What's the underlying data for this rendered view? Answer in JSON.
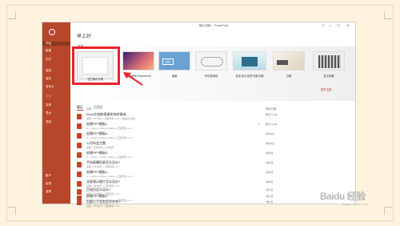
{
  "app": {
    "title": "演示文稿1 - PowerPoint",
    "window_controls": [
      "?",
      "—",
      "☐",
      "✕"
    ]
  },
  "sidebar": {
    "items": [
      {
        "label": "开始",
        "active": true
      },
      {
        "label": "新建"
      },
      {
        "label": "打开"
      },
      {
        "label": "信息"
      },
      {
        "label": "保存"
      },
      {
        "label": "另存为"
      },
      {
        "label": "打印"
      },
      {
        "label": "共享"
      },
      {
        "label": "导出"
      },
      {
        "label": "关闭"
      },
      {
        "label": "账户"
      },
      {
        "label": "反馈"
      },
      {
        "label": "选项"
      }
    ]
  },
  "home": {
    "greeting": "早上好",
    "new_label": "新建",
    "templates": [
      {
        "caption": "空白演示文稿"
      },
      {
        "caption": "欢迎使用 PowerPoint"
      },
      {
        "caption": "画廊",
        "thumb_text": "画廊"
      },
      {
        "caption": "环形装饰线"
      },
      {
        "caption": "包含“设计创意”的新文稿"
      },
      {
        "caption": "日照"
      },
      {
        "caption": "复古风格"
      }
    ],
    "more_themes": "更多主题 →",
    "tabs": [
      {
        "label": "最近",
        "active": true
      },
      {
        "label": "已固定"
      }
    ],
    "columns": {
      "name": "名称",
      "modified": "修改日期"
    },
    "recent_files": [
      {
        "name": "Word文档和表格如何转换成...",
        "path": "桌面 » PPT技巧 » 百度经验 » 2.8 » 桌面演示文稿",
        "date": "昨天 11:35",
        "pinned": false
      },
      {
        "name": "创建PPT模板1",
        "path": "D: » Users » Surlaq » Videos » 百度经验 » 2.3",
        "date": "昨天 11:05",
        "pinned": true
      },
      {
        "name": "创建PPT模板6",
        "path": "D: » Users » Surlaq » Videos » 百度经验 » 2.3",
        "date": "3月15日",
        "pinned": false
      },
      {
        "name": "公司年会主题",
        "path": "桌面 » 百度经验 » 公司文件",
        "date": "3月10日",
        "pinned": false
      },
      {
        "name": "创建PPT模板5",
        "path": "D: » Users » Surlaq » Videos » 百度经验 » 2.3",
        "date": "3月9日",
        "pinned": false
      },
      {
        "name": "手机屏幕投屏怎么设计?",
        "path": "桌面 » PPT技巧 » 百度经验 » 2.7",
        "date": "3月9日",
        "pinned": false
      },
      {
        "name": "创建PPT模板4",
        "path": "D: » Users » Surlaq » Videos » 百度经验 » 2.3",
        "date": "3月8日",
        "pinned": false
      },
      {
        "name": "全屏演示图片怎么设计?",
        "path": "桌面 » PPT技巧 » 百度经验 » 2.6",
        "date": "3月8日",
        "pinned": false
      },
      {
        "name": "目录页怎么设计?",
        "path": "桌面 » PPT技巧 » 百度经验 » 2.5",
        "date": "3月7日",
        "pinned": false
      },
      {
        "name": "创建PPT模板3",
        "path": "D: » Users » Surlaq » Videos » 百度经验 » 2.3",
        "date": "3月7日",
        "pinned": false
      },
      {
        "name": "页面上下左右怎么对齐?",
        "path": "桌面 » PPT技巧 » 百度经验 » 2.4",
        "date": "3月6日",
        "pinned": false
      }
    ]
  },
  "watermark": {
    "brand": "Baidu 经验",
    "sub": "jingyan.baidu.com"
  },
  "colors": {
    "accent": "#b7472a",
    "highlight": "#e8232a"
  }
}
